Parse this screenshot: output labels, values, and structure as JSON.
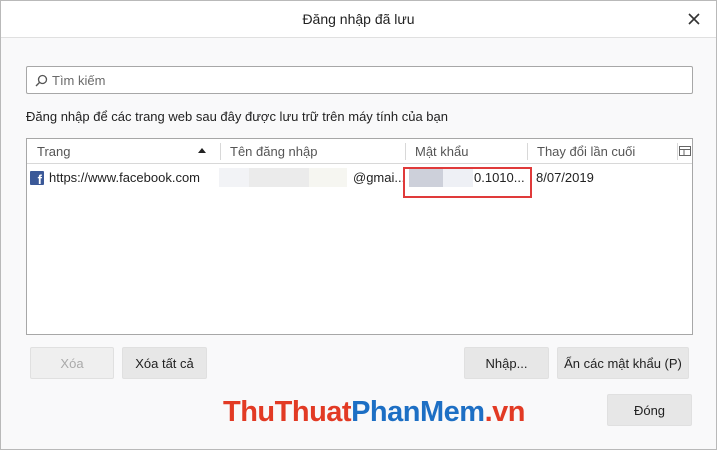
{
  "window": {
    "title": "Đăng nhập đã lưu"
  },
  "search": {
    "placeholder": "Tìm kiếm",
    "value": ""
  },
  "description": "Đăng nhập để các trang web sau đây được lưu trữ trên máy tính của bạn",
  "table": {
    "columns": [
      "Trang",
      "Tên đăng nhập",
      "Mật khẩu",
      "Thay đổi lần cuối"
    ],
    "sorted_column": "Trang",
    "rows": [
      {
        "site": "https://www.facebook.com",
        "username": "@gmai...",
        "password": "0.1010...",
        "last_changed": "8/07/2019"
      }
    ]
  },
  "buttons": {
    "delete": "Xóa",
    "delete_all": "Xóa tất cả",
    "import": "Nhập...",
    "hide_passwords": "Ẩn các mật khẩu (P)",
    "close": "Đóng"
  },
  "watermark": {
    "part1": "ThuThuat",
    "part2": "PhanMem",
    "part3": ".vn"
  },
  "colors": {
    "highlight": "#e03a3a",
    "facebook": "#3b5998",
    "watermark_red": "#e23a24",
    "watermark_blue": "#1d6fc4"
  },
  "icons": {
    "search": "search-icon",
    "close": "close-icon",
    "facebook": "facebook-favicon",
    "column_picker": "column-picker-icon",
    "sort": "sort-ascending-icon"
  }
}
